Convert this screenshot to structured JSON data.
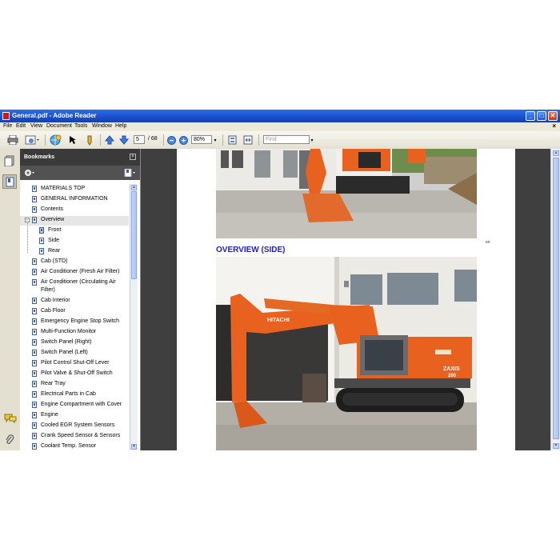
{
  "window": {
    "title": "General.pdf - Adobe Reader",
    "buttons": {
      "minimize": "_",
      "maximize": "□",
      "close": "✕"
    }
  },
  "menu": {
    "items": [
      "File",
      "Edit",
      "View",
      "Document",
      "Tools",
      "Window",
      "Help"
    ],
    "doc_close": "×"
  },
  "toolbar": {
    "current_page": "5",
    "page_separator": "/ 68",
    "zoom": "80%",
    "find_placeholder": "Find"
  },
  "bookmarks": {
    "title": "Bookmarks",
    "close": "×",
    "items": [
      {
        "label": "MATERIALS TOP",
        "level": 1
      },
      {
        "label": "GENERAL INFORMATION",
        "level": 1
      },
      {
        "label": "Contents",
        "level": 1
      },
      {
        "label": "Overview",
        "level": 1,
        "expanded": true,
        "selected": true
      },
      {
        "label": "Front",
        "level": 2
      },
      {
        "label": "Side",
        "level": 2
      },
      {
        "label": "Rear",
        "level": 2
      },
      {
        "label": "Cab (STD)",
        "level": 1
      },
      {
        "label": "Air Conditioner (Fresh Air Filter)",
        "level": 1
      },
      {
        "label": "Air Conditioner (Circulating Air",
        "label2": "Filter)",
        "level": 1
      },
      {
        "label": "Cab Interior",
        "level": 1
      },
      {
        "label": "Cab Floor",
        "level": 1
      },
      {
        "label": "Emergency Engine Stop Switch",
        "level": 1
      },
      {
        "label": "Multi-Function Monitor",
        "level": 1
      },
      {
        "label": "Switch Panel (Right)",
        "level": 1
      },
      {
        "label": "Switch Panel (Left)",
        "level": 1
      },
      {
        "label": "Pilot Control Shut-Off Lever",
        "level": 1
      },
      {
        "label": "Pilot Valve & Shut-Off Switch",
        "level": 1
      },
      {
        "label": "Rear Tray",
        "level": 1
      },
      {
        "label": "Electrical Parts in Cab",
        "level": 1
      },
      {
        "label": "Engine Compartment with Cover",
        "level": 1
      },
      {
        "label": "Engine",
        "level": 1
      },
      {
        "label": "Cooled EGR System Sensors",
        "level": 1
      },
      {
        "label": "Crank Speed Sensor & Sensors",
        "level": 1
      },
      {
        "label": "Coolant Temp. Sensor",
        "level": 1
      }
    ]
  },
  "document": {
    "section_heading": "OVERVIEW (SIDE)",
    "small_note": "en",
    "machine_brand": "HITACHI",
    "machine_model": "ZAXIS",
    "machine_number": "200"
  },
  "colors": {
    "titlebar": "#1f56d0",
    "heading_blue": "#1d1dc9",
    "excavator_orange": "#e8611e",
    "bookmark_panel_header": "#3a3a3a",
    "doc_background": "#3f3f3f"
  }
}
